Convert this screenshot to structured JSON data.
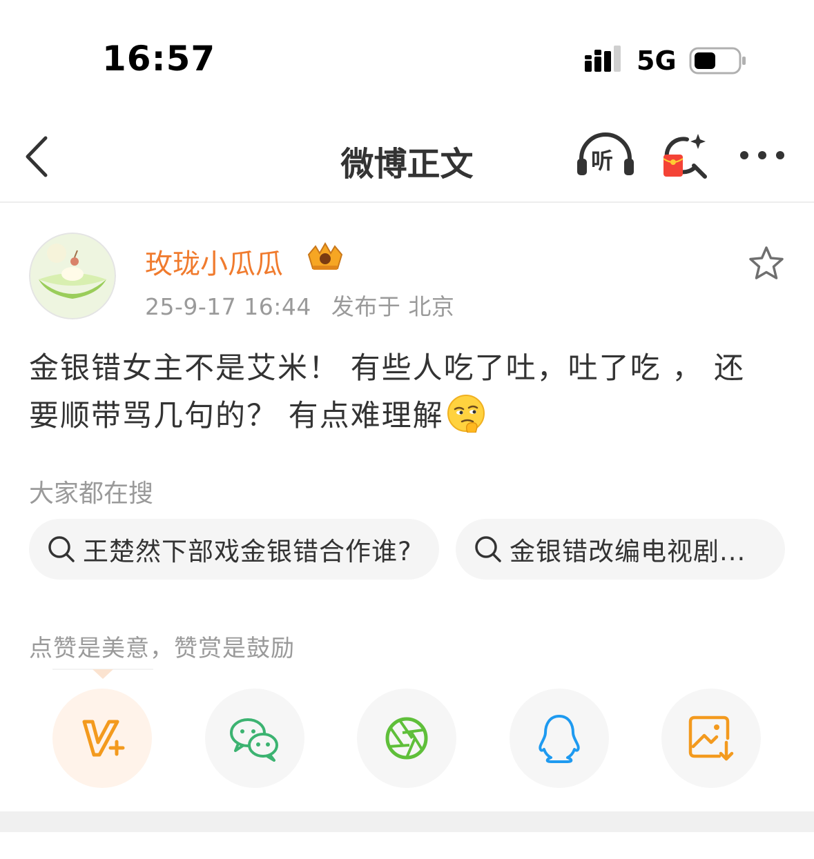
{
  "status_bar": {
    "time": "16:57",
    "network": "5G",
    "icons": [
      "signal-icon",
      "battery-icon"
    ]
  },
  "nav": {
    "title": "微博正文",
    "listen_label": "听",
    "icons": [
      "back-icon",
      "listen-icon",
      "red-packet-search-icon",
      "more-icon"
    ]
  },
  "author": {
    "name": "玫珑小瓜瓜",
    "timestamp": "25-9-17 16:44",
    "location": "发布于 北京",
    "icons": [
      "crown-badge-icon",
      "favorite-star-icon"
    ]
  },
  "post": {
    "line1": "金银错女主不是艾米！ 有些人吃了吐，吐了吃 ， 还",
    "line2": "要顺带骂几句的？ 有点难理解"
  },
  "search": {
    "label": "大家都在搜",
    "chips": [
      {
        "text": "王楚然下部戏金银错合作谁?"
      },
      {
        "text": "金银错改编电视剧..."
      }
    ]
  },
  "encourage": {
    "text": "点赞是美意，赞赏是鼓励",
    "share_icons": [
      "v-plus-reward-icon",
      "wechat-icon",
      "moments-icon",
      "qq-icon",
      "save-image-icon"
    ]
  },
  "colors": {
    "author_name": "#f07b2e",
    "muted": "#9a9a9a",
    "wechat": "#3cb371",
    "moments": "#5fbf3a",
    "qq": "#1e9af0",
    "orange": "#f39a1e"
  }
}
